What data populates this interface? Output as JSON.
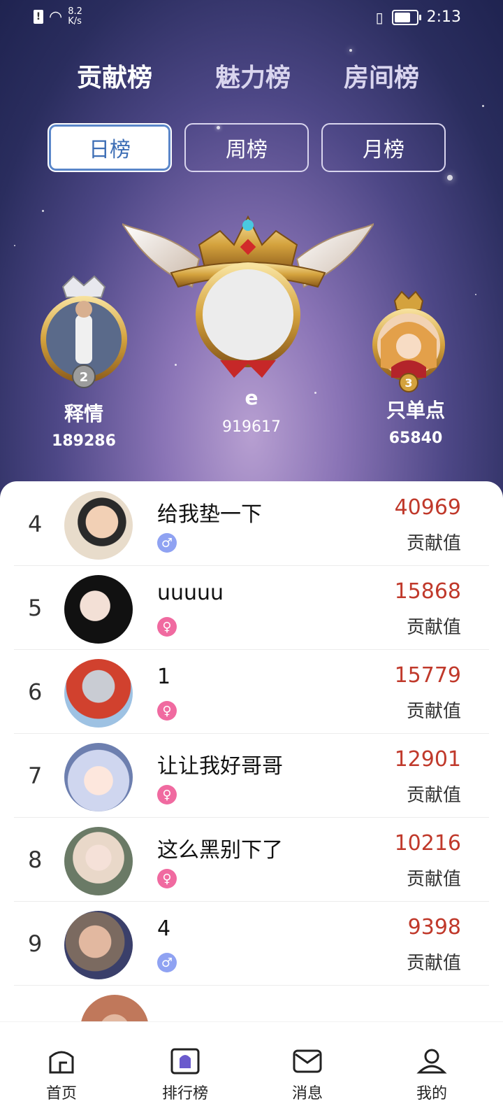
{
  "status_bar": {
    "speed_value": "8.2",
    "speed_unit": "K/s",
    "time": "2:13"
  },
  "top_tabs": [
    "贡献榜",
    "魅力榜",
    "房间榜"
  ],
  "period_tabs": [
    "日榜",
    "周榜",
    "月榜"
  ],
  "podium": {
    "first": {
      "name": "e",
      "score": "919617"
    },
    "second": {
      "name": "释情",
      "score": "189286",
      "badge": "2"
    },
    "third": {
      "name": "只单点",
      "score": "65840",
      "badge": "3"
    }
  },
  "list": [
    {
      "rank": "4",
      "name": "给我垫一下",
      "gender": "male",
      "score": "40969",
      "label": "贡献值"
    },
    {
      "rank": "5",
      "name": "uuuuu",
      "gender": "female",
      "score": "15868",
      "label": "贡献值"
    },
    {
      "rank": "6",
      "name": "1",
      "gender": "female",
      "score": "15779",
      "label": "贡献值"
    },
    {
      "rank": "7",
      "name": "让让我好哥哥",
      "gender": "female",
      "score": "12901",
      "label": "贡献值"
    },
    {
      "rank": "8",
      "name": "这么黑别下了",
      "gender": "female",
      "score": "10216",
      "label": "贡献值"
    },
    {
      "rank": "9",
      "name": "4",
      "gender": "male",
      "score": "9398",
      "label": "贡献值"
    }
  ],
  "bottom_nav": [
    "首页",
    "排行榜",
    "消息",
    "我的"
  ],
  "colors": {
    "accent": "#3d6eb5",
    "score": "#c0392b",
    "male": "#8fa2f2",
    "female": "#f06aa0"
  }
}
